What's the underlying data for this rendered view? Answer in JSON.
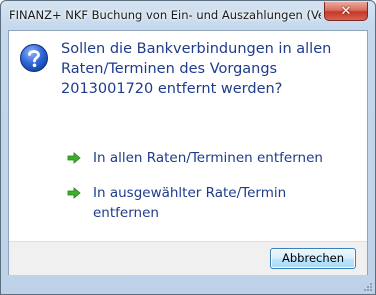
{
  "window": {
    "title": "FINANZ+ NKF Buchung von Ein- und Auszahlungen (Ver...",
    "close_label": "✕"
  },
  "dialog": {
    "icon": "question-icon",
    "message_lines": [
      "Sollen die Bankverbindungen in allen",
      "Raten/Terminen des Vorgangs",
      "2013001720 entfernt werden?"
    ],
    "options": [
      {
        "icon": "green-arrow-icon",
        "lines": [
          "In allen Raten/Terminen entfernen"
        ]
      },
      {
        "icon": "green-arrow-icon",
        "lines": [
          "In ausgewählter Rate/Termin",
          "entfernen"
        ]
      }
    ],
    "cancel_label": "Abbrechen"
  },
  "colors": {
    "accent_text": "#1f3c8c",
    "arrow_green": "#3fae2a",
    "close_red": "#c4382a"
  }
}
